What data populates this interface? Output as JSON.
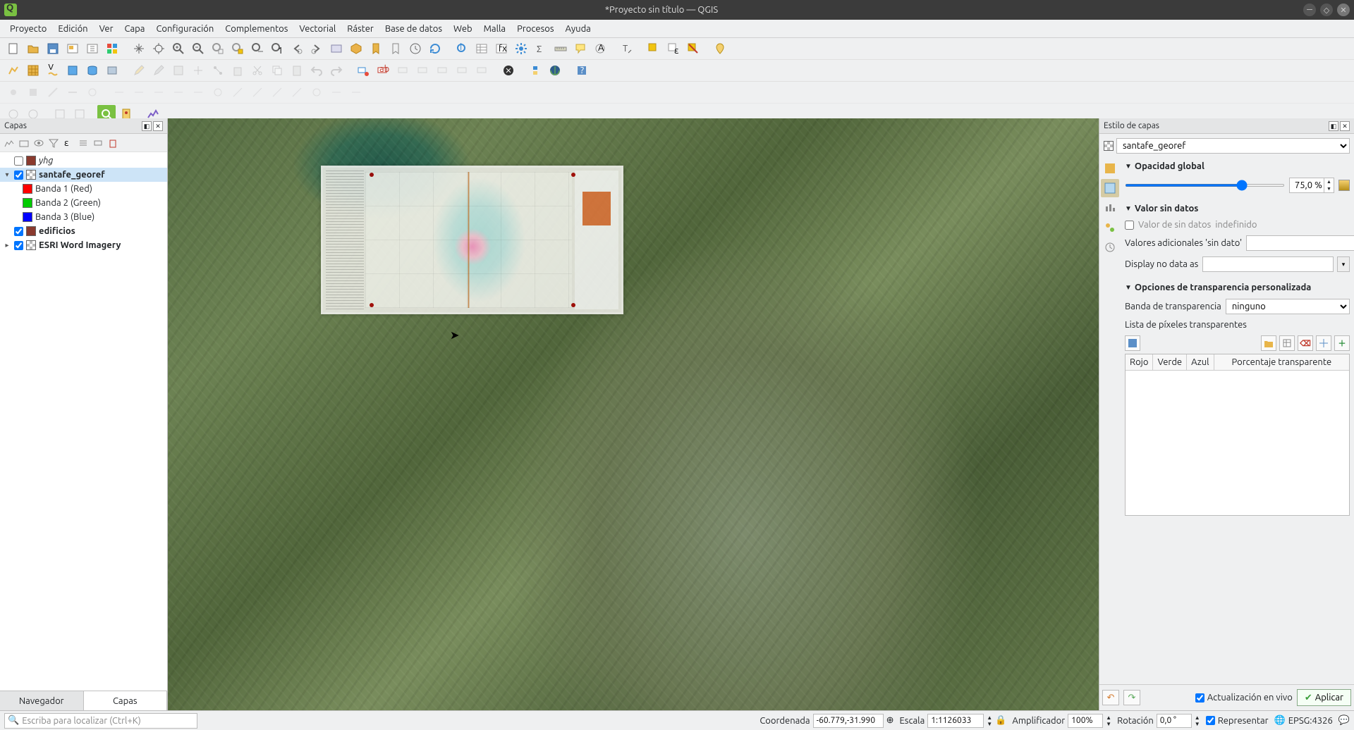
{
  "window": {
    "title": "*Proyecto sin título — QGIS"
  },
  "menu": [
    "Proyecto",
    "Edición",
    "Ver",
    "Capa",
    "Configuración",
    "Complementos",
    "Vectorial",
    "Ráster",
    "Base de datos",
    "Web",
    "Malla",
    "Procesos",
    "Ayuda"
  ],
  "panels": {
    "layers_title": "Capas",
    "style_title": "Estilo de capas",
    "tab_browser": "Navegador",
    "tab_layers": "Capas"
  },
  "layers": {
    "items": [
      {
        "name": "yhg",
        "checked": false,
        "italic": true
      },
      {
        "name": "santafe_georef",
        "checked": true,
        "bold": true,
        "selected": true,
        "expandable": true,
        "bands": [
          {
            "label": "Banda 1 (Red)",
            "color": "#ff0000"
          },
          {
            "label": "Banda 2 (Green)",
            "color": "#00cc00"
          },
          {
            "label": "Banda 3 (Blue)",
            "color": "#0000ff"
          }
        ]
      },
      {
        "name": "edificios",
        "checked": true,
        "swatch": "#8a3a2e"
      },
      {
        "name": "ESRI Word Imagery",
        "checked": true,
        "expandable": true
      }
    ]
  },
  "style_panel": {
    "current_layer": "santafe_georef",
    "opacity_header": "Opacidad global",
    "opacity_value": "75,0 %",
    "nodata_header": "Valor sin datos",
    "nodata_checkbox": "Valor de sin datos",
    "nodata_undefined": "indefinido",
    "nodata_extra": "Valores adicionales 'sin dato'",
    "display_nodata": "Display no data as",
    "custom_trans_header": "Opciones de transparencia personalizada",
    "trans_band_label": "Banda de transparencia",
    "trans_band_value": "ninguno",
    "pixel_list_label": "Lista de píxeles transparentes",
    "table_headers": [
      "Rojo",
      "Verde",
      "Azul",
      "Porcentaje transparente"
    ],
    "live_update": "Actualización en vivo",
    "apply": "Aplicar"
  },
  "statusbar": {
    "locator_placeholder": "Escriba para localizar (Ctrl+K)",
    "coord_label": "Coordenada",
    "coord_value": "-60.779,-31.990",
    "scale_label": "Escala",
    "scale_value": "1:1126033",
    "magnifier_label": "Amplificador",
    "magnifier_value": "100%",
    "rotation_label": "Rotación",
    "rotation_value": "0,0 °",
    "render_label": "Representar",
    "crs": "EPSG:4326"
  }
}
